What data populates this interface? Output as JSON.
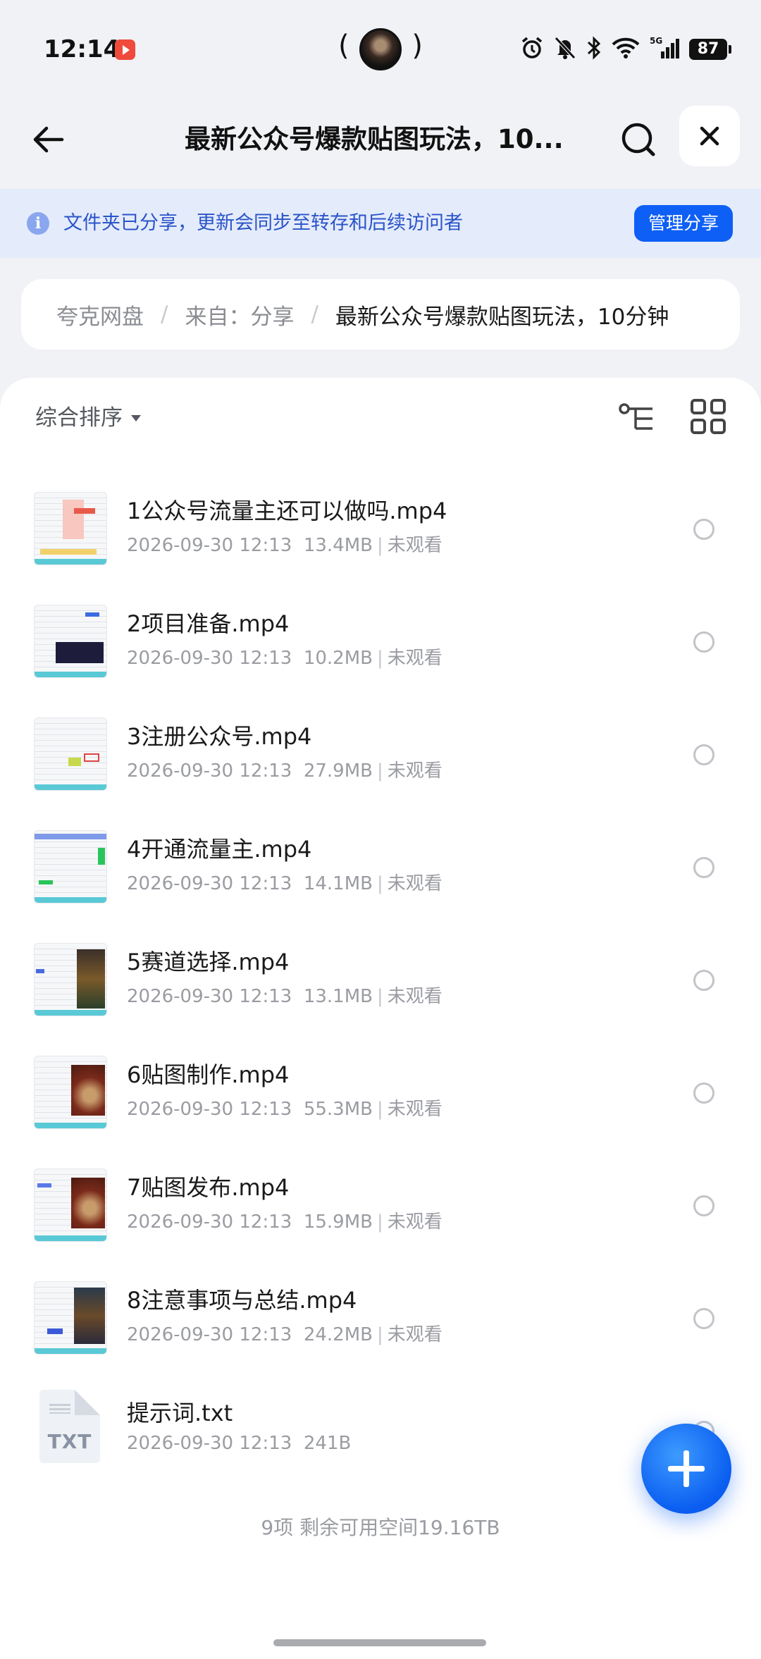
{
  "status_bar": {
    "time": "12:14",
    "battery": "87",
    "network": "5G",
    "icons": [
      "alarm-icon",
      "mute-icon",
      "bluetooth-icon",
      "wifi-icon",
      "signal-icon",
      "battery-icon"
    ]
  },
  "nav": {
    "title": "最新公众号爆款贴图玩法，10..."
  },
  "banner": {
    "text": "文件夹已分享，更新会同步至转存和后续访问者",
    "manage_label": "管理分享"
  },
  "breadcrumb": {
    "items": [
      "夸克网盘",
      "来自：分享",
      "最新公众号爆款贴图玩法，10分钟"
    ]
  },
  "toolbar": {
    "sort_label": "综合排序"
  },
  "files": [
    {
      "name": "1公众号流量主还可以做吗.mp4",
      "date": "2026-09-30 12:13",
      "size": "13.4MB",
      "status": "未观看",
      "type": "video"
    },
    {
      "name": "2项目准备.mp4",
      "date": "2026-09-30 12:13",
      "size": "10.2MB",
      "status": "未观看",
      "type": "video"
    },
    {
      "name": "3注册公众号.mp4",
      "date": "2026-09-30 12:13",
      "size": "27.9MB",
      "status": "未观看",
      "type": "video"
    },
    {
      "name": "4开通流量主.mp4",
      "date": "2026-09-30 12:13",
      "size": "14.1MB",
      "status": "未观看",
      "type": "video"
    },
    {
      "name": "5赛道选择.mp4",
      "date": "2026-09-30 12:13",
      "size": "13.1MB",
      "status": "未观看",
      "type": "video"
    },
    {
      "name": "6贴图制作.mp4",
      "date": "2026-09-30 12:13",
      "size": "55.3MB",
      "status": "未观看",
      "type": "video"
    },
    {
      "name": "7贴图发布.mp4",
      "date": "2026-09-30 12:13",
      "size": "15.9MB",
      "status": "未观看",
      "type": "video"
    },
    {
      "name": "8注意事项与总结.mp4",
      "date": "2026-09-30 12:13",
      "size": "24.2MB",
      "status": "未观看",
      "type": "video"
    },
    {
      "name": "提示词.txt",
      "date": "2026-09-30 12:13",
      "size": "241B",
      "status": "",
      "type": "txt",
      "icon_label": "TXT"
    }
  ],
  "footer": {
    "summary": "9项 剩余可用空间19.16TB"
  },
  "colors": {
    "accent": "#0d5ff5",
    "banner_bg": "#e4ebfb",
    "banner_text": "#2a54c8"
  }
}
